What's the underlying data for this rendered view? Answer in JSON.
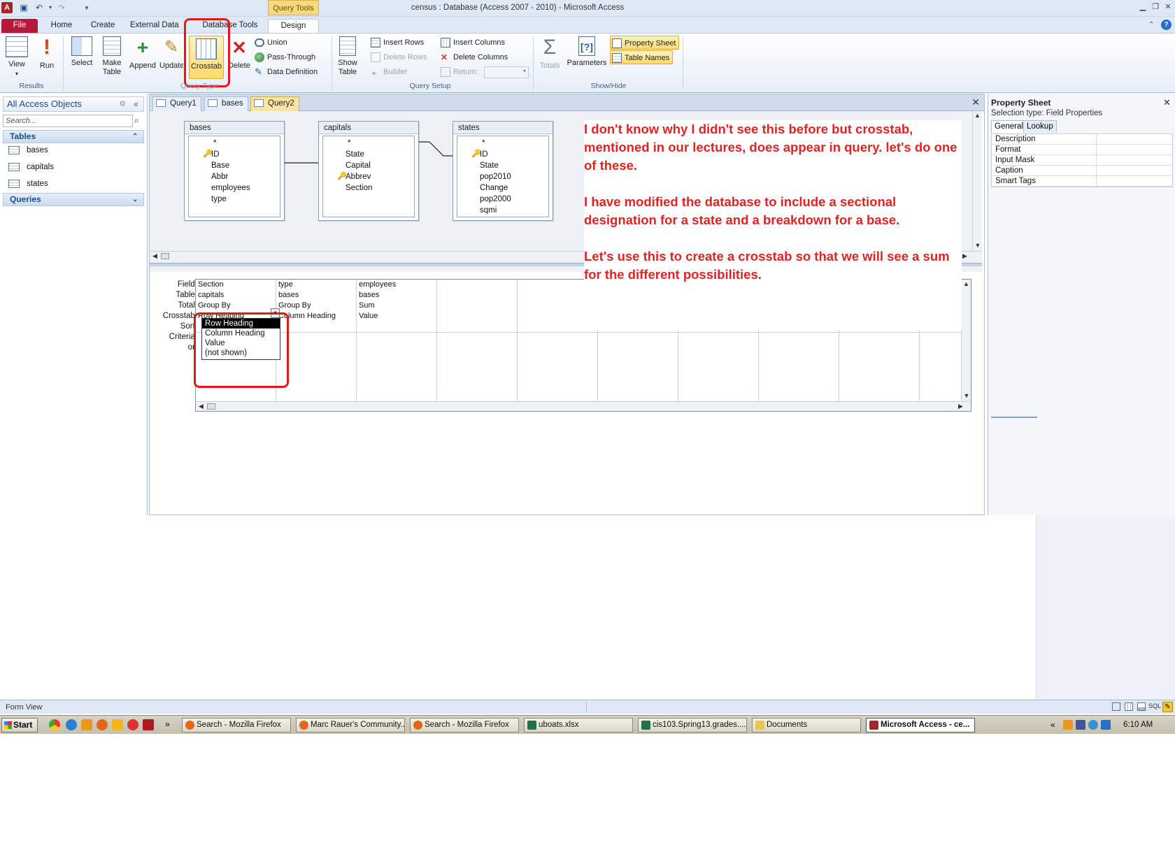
{
  "titlebar": {
    "title": "census : Database (Access 2007 - 2010)  -  Microsoft Access",
    "context_tab": "Query Tools"
  },
  "ribbon_tabs": [
    "File",
    "Home",
    "Create",
    "External Data",
    "Database Tools",
    "Design"
  ],
  "ribbon": {
    "results": {
      "view": "View",
      "run": "Run",
      "group": "Results"
    },
    "query_type": {
      "select": "Select",
      "make_table": "Make Table",
      "append": "Append",
      "update": "Update",
      "crosstab": "Crosstab",
      "delete": "Delete",
      "union": "Union",
      "pass_through": "Pass-Through",
      "data_definition": "Data Definition",
      "group": "Query Type"
    },
    "query_setup": {
      "show_table": "Show Table",
      "insert_rows": "Insert Rows",
      "delete_rows": "Delete Rows",
      "builder": "Builder",
      "insert_columns": "Insert Columns",
      "delete_columns": "Delete Columns",
      "return": "Return:",
      "group": "Query Setup"
    },
    "show_hide": {
      "totals": "Totals",
      "parameters": "Parameters",
      "property_sheet": "Property Sheet",
      "table_names": "Table Names",
      "group": "Show/Hide"
    }
  },
  "nav": {
    "header": "All Access Objects",
    "search_placeholder": "Search...",
    "tables_group": "Tables",
    "tables": [
      "bases",
      "capitals",
      "states"
    ],
    "queries_group": "Queries"
  },
  "doc_tabs": [
    "Query1",
    "bases",
    "Query2"
  ],
  "field_lists": [
    {
      "name": "bases",
      "fields": [
        "*",
        "ID",
        "Base",
        "Abbr",
        "employees",
        "type"
      ],
      "key": "ID"
    },
    {
      "name": "capitals",
      "fields": [
        "*",
        "State",
        "Capital",
        "Abbrev",
        "Section"
      ],
      "key": "Abbrev"
    },
    {
      "name": "states",
      "fields": [
        "*",
        "ID",
        "State",
        "pop2010",
        "Change",
        "pop2000",
        "sqmi"
      ],
      "key": "ID"
    }
  ],
  "note": {
    "p1": "I don't know why I didn't see this before but crosstab, mentioned in our lectures, does appear in query. let's do one of these.",
    "p2": "I have modified the database to include a sectional designation for a state and a breakdown for a base.",
    "p3": "Let's use this to create a crosstab so that we will see a sum for the different possibilities."
  },
  "grid": {
    "row_labels": [
      "Field:",
      "Table:",
      "Total:",
      "Crosstab:",
      "Sort:",
      "Criteria:",
      "or:"
    ],
    "columns": [
      {
        "field": "Section",
        "table": "capitals",
        "total": "Group By",
        "crosstab": "Row Heading"
      },
      {
        "field": "type",
        "table": "bases",
        "total": "Group By",
        "crosstab": "Column Heading"
      },
      {
        "field": "employees",
        "table": "bases",
        "total": "Sum",
        "crosstab": "Value"
      }
    ],
    "dropdown_options": [
      "Row Heading",
      "Column Heading",
      "Value",
      "(not shown)"
    ]
  },
  "property_sheet": {
    "title": "Property Sheet",
    "selection_type": "Selection type:  Field Properties",
    "tabs": [
      "General",
      "Lookup"
    ],
    "rows": [
      "Description",
      "Format",
      "Input Mask",
      "Caption",
      "Smart Tags"
    ]
  },
  "status": {
    "text": "Form View"
  },
  "taskbar": {
    "start": "Start",
    "tasks": [
      "Search - Mozilla Firefox",
      "Marc Rauer's Community...",
      "Search - Mozilla Firefox",
      "uboats.xlsx",
      "cis103.Spring13.grades....",
      "Documents",
      "Microsoft Access - ce..."
    ],
    "clock": "6:10 AM"
  },
  "colors": {
    "annotation": "#e02424",
    "file_tab": "#b8173b",
    "highlight": "#ffd96a"
  }
}
